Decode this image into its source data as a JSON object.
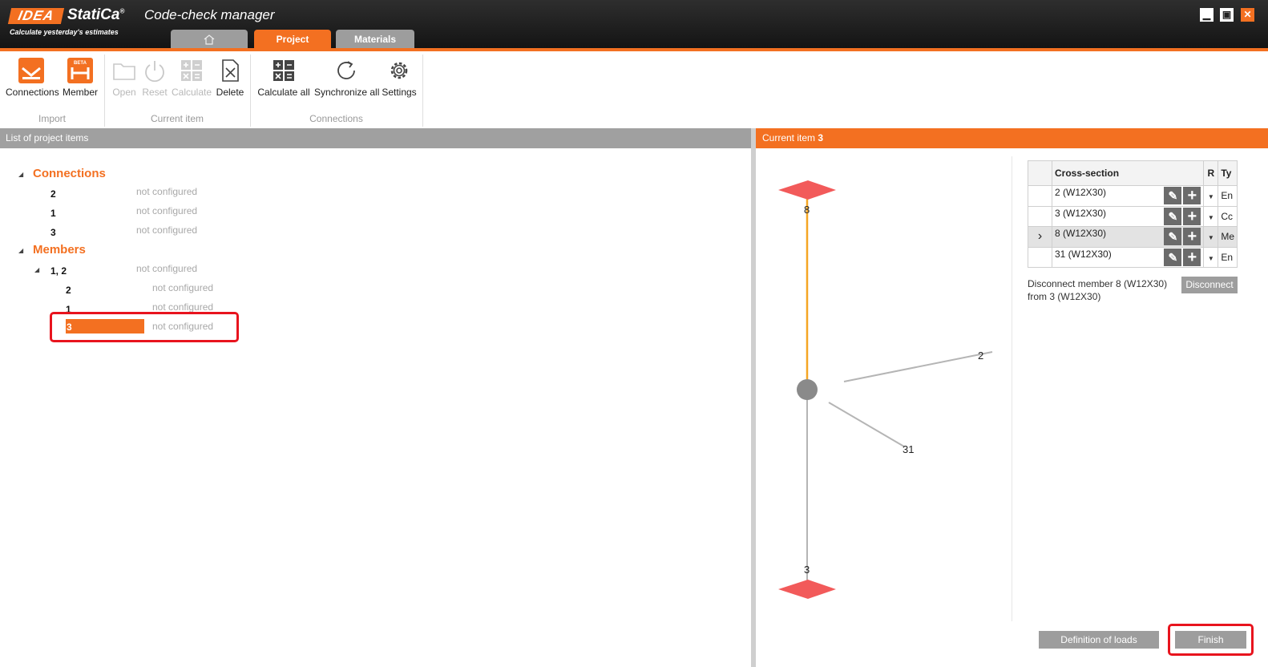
{
  "app": {
    "logo_box": "IDEA",
    "logo_name": "StatiCa",
    "logo_mark": "®",
    "tagline": "Calculate yesterday's estimates",
    "title": "Code-check manager"
  },
  "tabs": {
    "home_icon": "home-icon",
    "project": "Project",
    "materials": "Materials"
  },
  "window": {
    "minimize": "▁",
    "maximize": "▣",
    "close": "✕"
  },
  "ribbon": {
    "import": {
      "label": "Import",
      "connections": "Connections",
      "member": "Member",
      "beta": "BETA"
    },
    "current_item": {
      "label": "Current item",
      "open": "Open",
      "reset": "Reset",
      "calculate": "Calculate",
      "delete": "Delete"
    },
    "connections": {
      "label": "Connections",
      "calculate_all": "Calculate all",
      "synchronize_all": "Synchronize all",
      "settings": "Settings"
    }
  },
  "left_panel": {
    "title": "List of project items",
    "connections_title": "Connections",
    "members_title": "Members",
    "connections": [
      {
        "id": "2",
        "status": "not configured"
      },
      {
        "id": "1",
        "status": "not configured"
      },
      {
        "id": "3",
        "status": "not configured"
      }
    ],
    "members_group": {
      "id": "1, 2",
      "status": "not configured"
    },
    "members": [
      {
        "id": "2",
        "status": "not configured"
      },
      {
        "id": "1",
        "status": "not configured"
      },
      {
        "id": "3",
        "status": "not configured",
        "selected": true
      }
    ]
  },
  "right_panel": {
    "title_prefix": "Current item",
    "title_id": "3",
    "viewport": {
      "labels": {
        "top": "8",
        "right": "2",
        "diag": "31",
        "bottom": "3"
      },
      "colors": {
        "support": "#f25a5a",
        "active_member": "#f5a623",
        "member": "#b5b5b5",
        "node": "#8a8a8a"
      }
    },
    "table": {
      "headers": {
        "cross_section": "Cross-section",
        "r": "R",
        "type": "Ty"
      },
      "rows": [
        {
          "arrow": "",
          "section": "2 (W12X30)",
          "type": "En"
        },
        {
          "arrow": "",
          "section": "3 (W12X30)",
          "type": "Cc"
        },
        {
          "arrow": "›",
          "section": "8 (W12X30)",
          "type": "Me"
        },
        {
          "arrow": "",
          "section": "31 (W12X30)",
          "type": "En"
        }
      ]
    },
    "disconnect_text": "Disconnect member 8 (W12X30) from 3 (W12X30)",
    "disconnect_button": "Disconnect",
    "definition_of_loads": "Definition of loads",
    "finish": "Finish"
  },
  "colors": {
    "accent": "#f37021",
    "highlight": "#e8141e"
  }
}
